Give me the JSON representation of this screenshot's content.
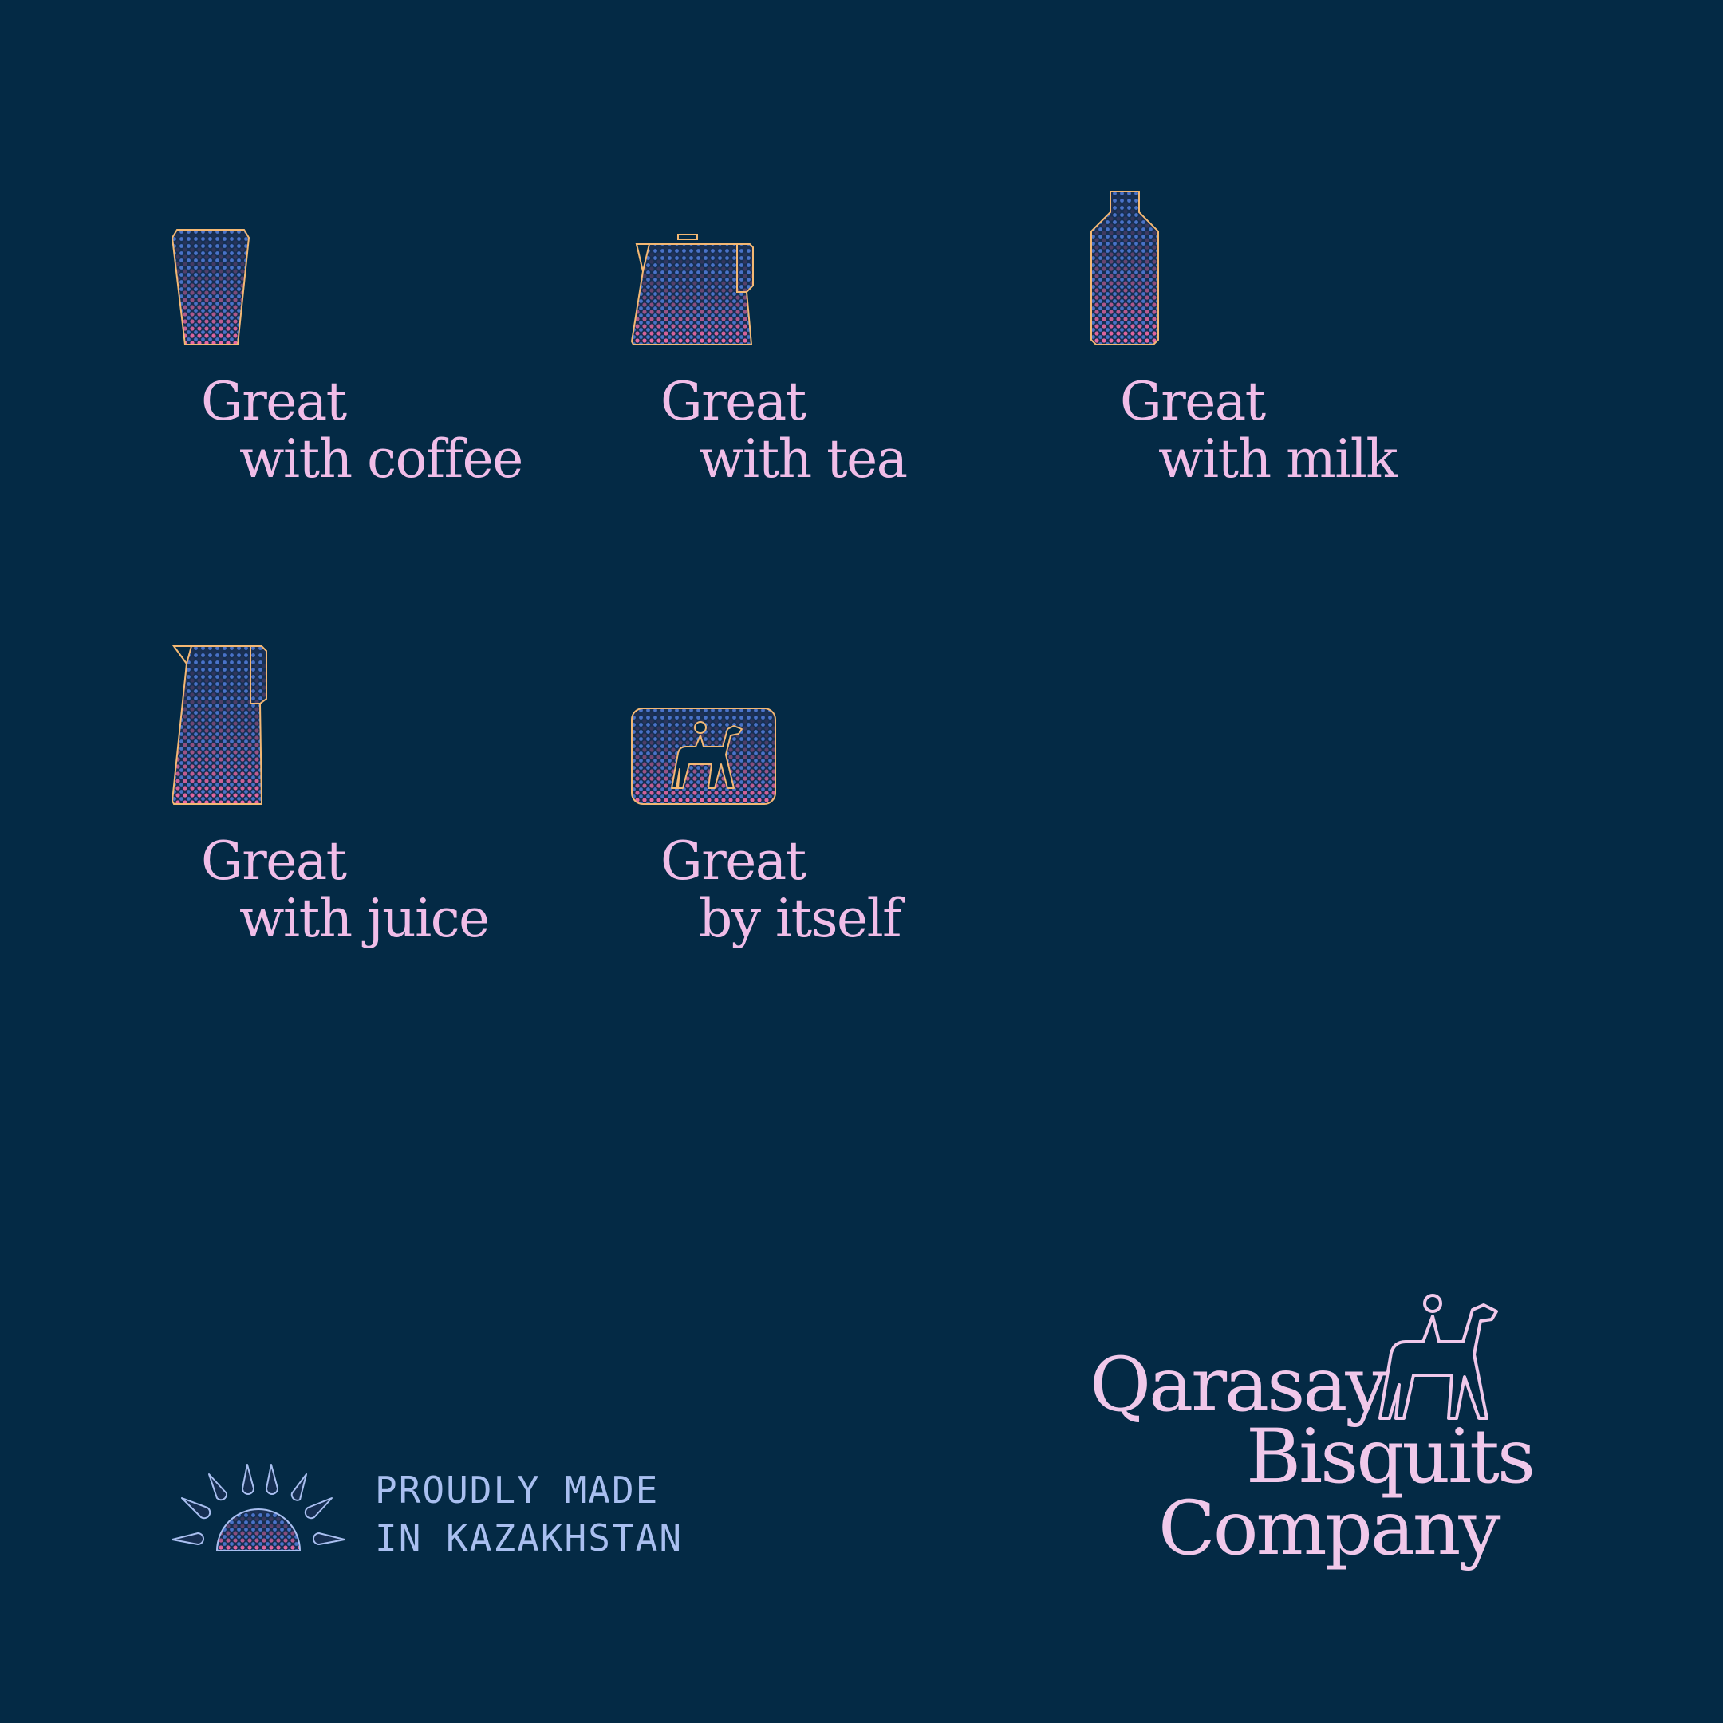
{
  "colors": {
    "background": "#042a45",
    "caption_pink": "#f0bde8",
    "brand_pink": "#f0c8ea",
    "label_lavender": "#a9bff0",
    "icon_outline": "#f4b873",
    "halftone_blue": "#4a72c8",
    "halftone_pink": "#f06aa6"
  },
  "pairings": [
    {
      "icon": "coffee-cup-icon",
      "line1": "Great",
      "line2": "with coffee"
    },
    {
      "icon": "teapot-icon",
      "line1": "Great",
      "line2": "with tea"
    },
    {
      "icon": "milk-bottle-icon",
      "line1": "Great",
      "line2": "with milk"
    },
    {
      "icon": "juice-jug-icon",
      "line1": "Great",
      "line2": "with juice"
    },
    {
      "icon": "biscuit-horse-rider-icon",
      "line1": "Great",
      "line2": "by itself"
    }
  ],
  "footer": {
    "made_in": {
      "icon": "rising-sun-icon",
      "line1": "PROUDLY MADE",
      "line2": "IN KAZAKHSTAN"
    },
    "brand": {
      "icon": "horse-rider-logo-icon",
      "line1": "Qarasay",
      "line2": "Bisquits",
      "line3": "Company"
    }
  }
}
